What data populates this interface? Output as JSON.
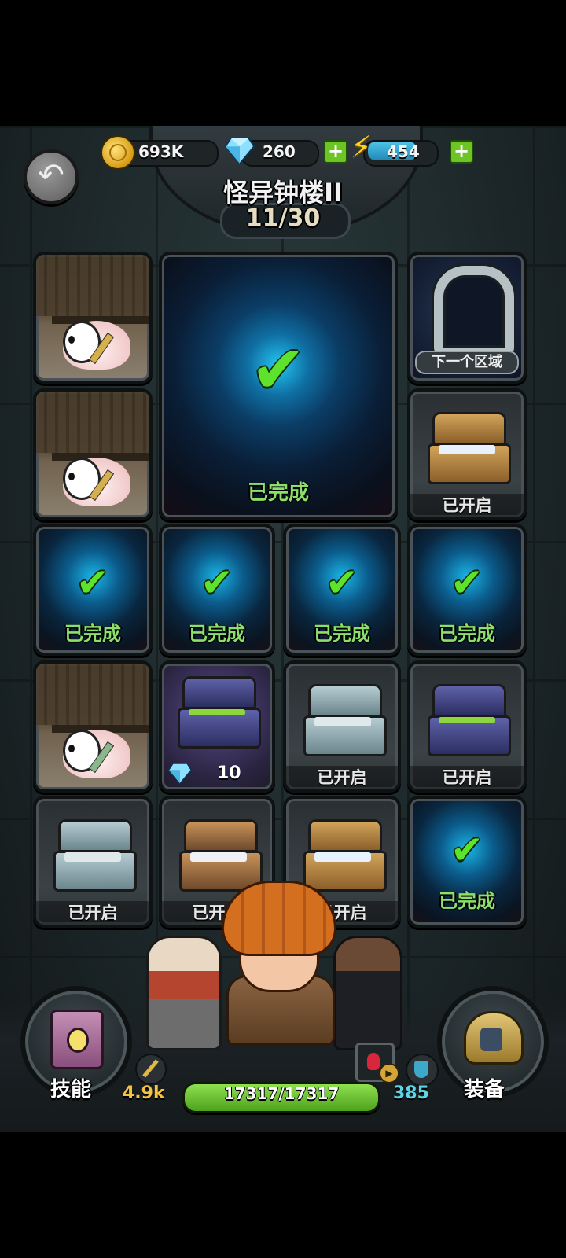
{
  "header": {
    "title": "怪异钟楼II",
    "progress": "11/30"
  },
  "currency": {
    "gold": "693K",
    "gems": "260",
    "energy": "454",
    "plus_symbol": "+"
  },
  "icons": {
    "back": "back-arrow-icon",
    "gold": "gold-coin-icon",
    "gem": "diamond-icon",
    "energy": "lightning-icon",
    "check": "checkmark-icon"
  },
  "grid": {
    "completed_label": "已完成",
    "opened_label": "已开启",
    "next_area_label": "下一个区域",
    "chest_cost": "10",
    "check_symbol": "✔"
  },
  "bottom": {
    "skills_label": "技能",
    "equipment_label": "装备",
    "attack": "4.9k",
    "hp": "17317/17317",
    "defense": "385",
    "hp_fill": 1.0
  },
  "colors": {
    "completed_text": "#8be06b",
    "check": "#5ee32d",
    "hp_bar": "#6cc425",
    "attack_text": "#f5c242",
    "defense_text": "#5fd4e8"
  }
}
